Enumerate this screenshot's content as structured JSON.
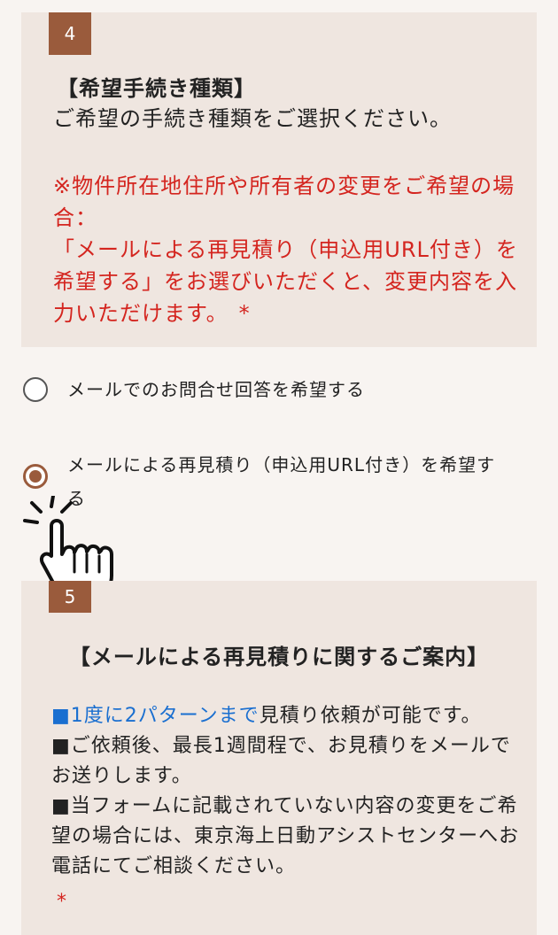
{
  "section4": {
    "number": "4",
    "title": "【希望手続き種類】",
    "description": "ご希望の手続き種類をご選択ください。",
    "note_line1": "※物件所在地住所や所有者の変更をご希望の場合：",
    "note_line2": "「メールによる再見積り（申込用URL付き）を希望する」をお選びいただくと、変更内容を入力いただけます。",
    "required_mark": "*",
    "options": [
      {
        "label": "メールでのお問合せ回答を希望する",
        "selected": false
      },
      {
        "label": "メールによる再見積り（申込用URL付き）を希望する",
        "selected": true
      }
    ]
  },
  "section5": {
    "number": "5",
    "title": "【メールによる再見積りに関するご案内】",
    "item1_highlight": "■1度に2パターンまで",
    "item1_rest": "見積り依頼が可能です。",
    "item2": "■ご依頼後、最長1週間程で、お見積りをメールでお送りします。",
    "item3": "■当フォームに記載されていない内容の変更をご希望の場合には、東京海上日動アシストセンターへお電話にてご相談ください。",
    "required_mark": "*"
  },
  "colors": {
    "accent": "#9a5b3c",
    "warning": "#d4251f",
    "link": "#1a6fd0",
    "panel": "#efe6e0"
  },
  "icons": {
    "pointer": "tap-hand-icon"
  }
}
